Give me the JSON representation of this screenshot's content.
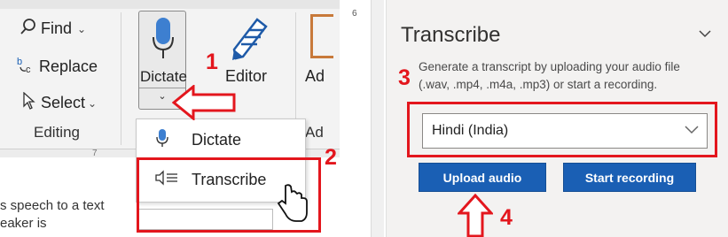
{
  "ribbon": {
    "find_label": "Find",
    "replace_label": "Replace",
    "select_label": "Select",
    "editing_group_label": "Editing",
    "dictate_label": "Dictate",
    "editor_label": "Editor",
    "addins_partial_label": "Ad",
    "addins_partial_label_2": "Ad",
    "ruler_mark": "7",
    "icons": {
      "find": "search-icon",
      "replace": "replace-icon",
      "select": "select-cursor-icon",
      "dictate": "microphone-icon",
      "editor": "editor-pen-icon",
      "expand": "chevron-down-icon"
    }
  },
  "dictate_menu": {
    "items": [
      {
        "label": "Dictate",
        "icon": "microphone-icon"
      },
      {
        "label": "Transcribe",
        "icon": "transcribe-icon"
      }
    ]
  },
  "document_text": {
    "line1": "s speech to a text",
    "line2": "eaker is"
  },
  "transcribe_pane": {
    "page_number": "6",
    "title": "Transcribe",
    "description": "Generate a transcript by uploading your audio file (.wav, .mp4, .m4a, .mp3) or start a recording.",
    "language_value": "Hindi (India)",
    "upload_button": "Upload audio",
    "record_button": "Start recording"
  },
  "annotations": {
    "step1": "1",
    "step2": "2",
    "step3": "3",
    "step4": "4",
    "highlight_color": "#e3161d"
  },
  "colors": {
    "primary_button": "#1a5fb4",
    "ribbon_bg": "#f3f3f3",
    "pane_bg": "#f3f2f1"
  }
}
